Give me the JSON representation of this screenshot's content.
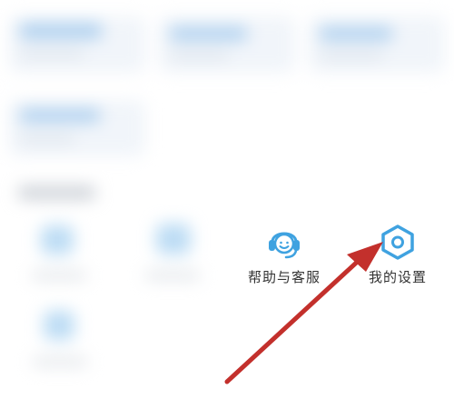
{
  "shortcuts": {
    "help": {
      "label": "帮助与客服",
      "icon": "headset-icon"
    },
    "settings": {
      "label": "我的设置",
      "icon": "hexagon-gear-icon"
    }
  },
  "colors": {
    "icon_blue": "#3fa2e0",
    "arrow_red": "#c3302c",
    "label_text": "#333333"
  }
}
